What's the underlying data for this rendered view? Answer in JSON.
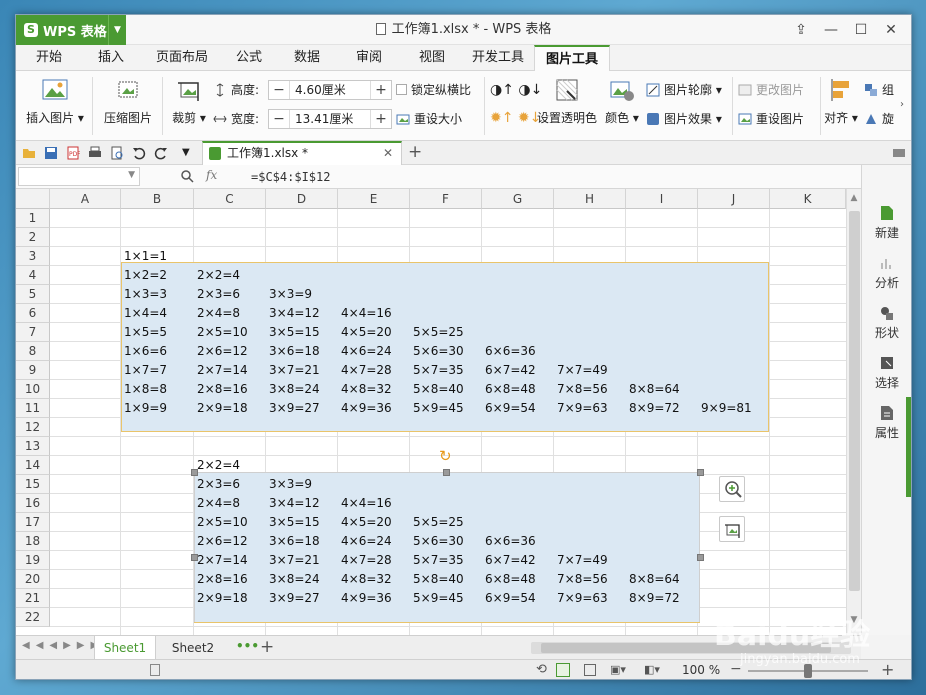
{
  "app": {
    "name": "WPS 表格",
    "doc_title": "工作簿1.xlsx * - WPS 表格"
  },
  "tabs": [
    "开始",
    "插入",
    "页面布局",
    "公式",
    "数据",
    "审阅",
    "视图",
    "开发工具",
    "图片工具"
  ],
  "active_tab": "图片工具",
  "ribbon": {
    "insert_picture": "插入图片",
    "compress_picture": "压缩图片",
    "crop": "裁剪",
    "height_label": "高度:",
    "height_value": "4.60厘米",
    "width_label": "宽度:",
    "width_value": "13.41厘米",
    "lock_ratio": "锁定纵横比",
    "reset_size": "重设大小",
    "set_transparent": "设置透明色",
    "color": "颜色",
    "picture_outline": "图片轮廓",
    "picture_effect": "图片效果",
    "change_picture": "更改图片",
    "reset_picture": "重设图片",
    "align": "对齐",
    "group": "组",
    "rotate": "旋"
  },
  "doc_tab": "工作簿1.xlsx *",
  "formula_bar": {
    "fx": "fx",
    "formula": "=$C$4:$I$12"
  },
  "columns": [
    "A",
    "B",
    "C",
    "D",
    "E",
    "F",
    "G",
    "H",
    "I",
    "J",
    "K"
  ],
  "rows": [
    "1",
    "2",
    "3",
    "4",
    "5",
    "6",
    "7",
    "8",
    "9",
    "10",
    "11",
    "12",
    "13",
    "14",
    "15",
    "16",
    "17",
    "18",
    "19",
    "20",
    "21",
    "22"
  ],
  "table1": [
    [
      "1×1=1"
    ],
    [
      "1×2=2",
      "2×2=4"
    ],
    [
      "1×3=3",
      "2×3=6",
      "3×3=9"
    ],
    [
      "1×4=4",
      "2×4=8",
      "3×4=12",
      "4×4=16"
    ],
    [
      "1×5=5",
      "2×5=10",
      "3×5=15",
      "4×5=20",
      "5×5=25"
    ],
    [
      "1×6=6",
      "2×6=12",
      "3×6=18",
      "4×6=24",
      "5×6=30",
      "6×6=36"
    ],
    [
      "1×7=7",
      "2×7=14",
      "3×7=21",
      "4×7=28",
      "5×7=35",
      "6×7=42",
      "7×7=49"
    ],
    [
      "1×8=8",
      "2×8=16",
      "3×8=24",
      "4×8=32",
      "5×8=40",
      "6×8=48",
      "7×8=56",
      "8×8=64"
    ],
    [
      "1×9=9",
      "2×9=18",
      "3×9=27",
      "4×9=36",
      "5×9=45",
      "6×9=54",
      "7×9=63",
      "8×9=72",
      "9×9=81"
    ]
  ],
  "table2": [
    [
      "2×2=4"
    ],
    [
      "2×3=6",
      "3×3=9"
    ],
    [
      "2×4=8",
      "3×4=12",
      "4×4=16"
    ],
    [
      "2×5=10",
      "3×5=15",
      "4×5=20",
      "5×5=25"
    ],
    [
      "2×6=12",
      "3×6=18",
      "4×6=24",
      "5×6=30",
      "6×6=36"
    ],
    [
      "2×7=14",
      "3×7=21",
      "4×7=28",
      "5×7=35",
      "6×7=42",
      "7×7=49"
    ],
    [
      "2×8=16",
      "3×8=24",
      "4×8=32",
      "5×8=40",
      "6×8=48",
      "7×8=56",
      "8×8=64"
    ],
    [
      "2×9=18",
      "3×9=27",
      "4×9=36",
      "5×9=45",
      "6×9=54",
      "7×9=63",
      "8×9=72"
    ]
  ],
  "task_pane": [
    "新建",
    "分析",
    "形状",
    "选择",
    "属性"
  ],
  "sheets": [
    "Sheet1",
    "Sheet2"
  ],
  "status": {
    "zoom": "100 %"
  },
  "watermark": {
    "text": "Baidu经验",
    "url": "jingyan.baidu.com"
  },
  "colors": {
    "accent": "#4a9a32",
    "selection_fill": "#dbe8f3",
    "picture_border": "#e9c46a"
  }
}
